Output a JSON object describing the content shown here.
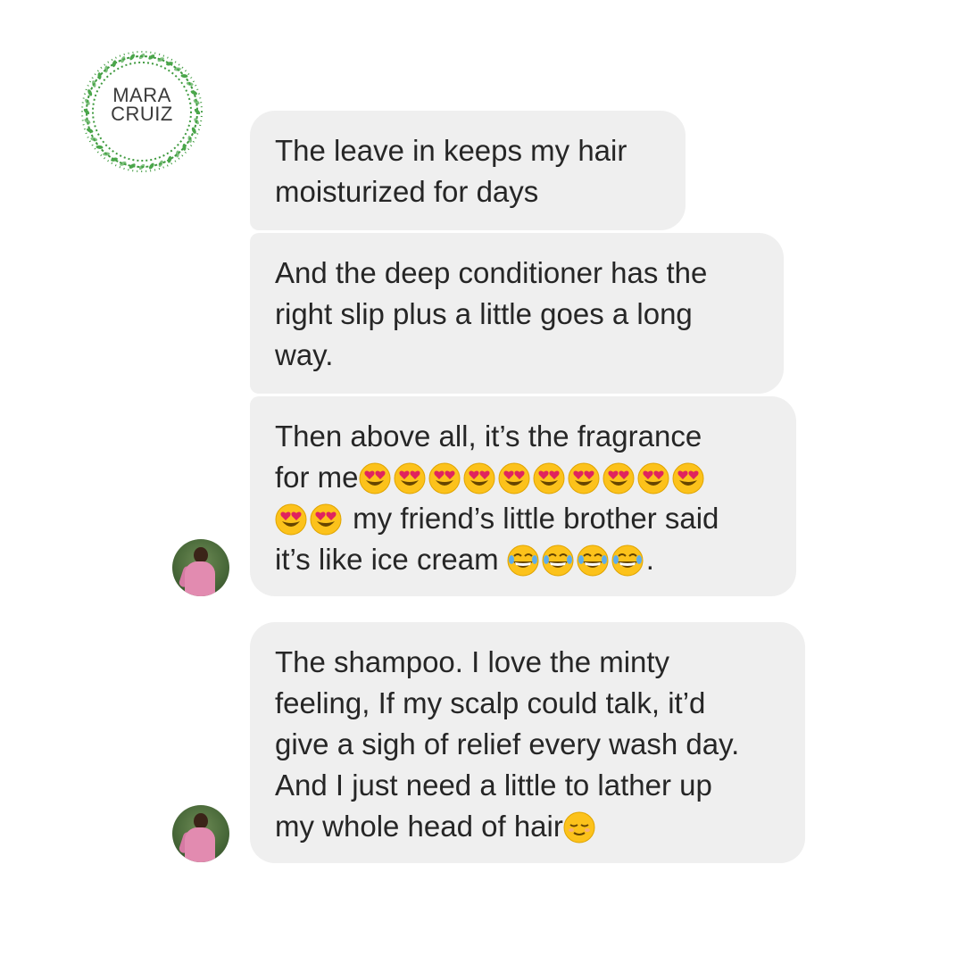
{
  "brand": {
    "line1": "MARA",
    "line2": "CRUIZ",
    "accent_color": "#3f9a3f"
  },
  "messages": [
    {
      "lines": [
        "The leave in keeps my hair",
        "moisturized for days"
      ]
    },
    {
      "lines": [
        "And the deep conditioner has the",
        "right slip plus a little goes a long",
        "way."
      ]
    },
    {
      "line1": "Then above all, it’s the fragrance",
      "line2_text": "for me",
      "line2_emoji_count": 10,
      "line3_emoji_count": 2,
      "line3_text": " my friend’s little brother said",
      "line4_text": "it’s like ice cream ",
      "line4_emoji_count": 4,
      "line4_suffix": ".",
      "emoji_heart_eyes": "smiling-face-with-heart-eyes",
      "emoji_tears_joy": "face-with-tears-of-joy"
    },
    {
      "lines": [
        "The shampoo. I love the minty",
        "feeling, If my scalp could talk, it’d",
        "give a sigh of relief every wash day.",
        "And I just need a little to lather up"
      ],
      "last_line": "my whole head of hair",
      "end_emoji": "relieved-face"
    }
  ],
  "colors": {
    "bubble_bg": "#efefef",
    "text": "#262626"
  }
}
